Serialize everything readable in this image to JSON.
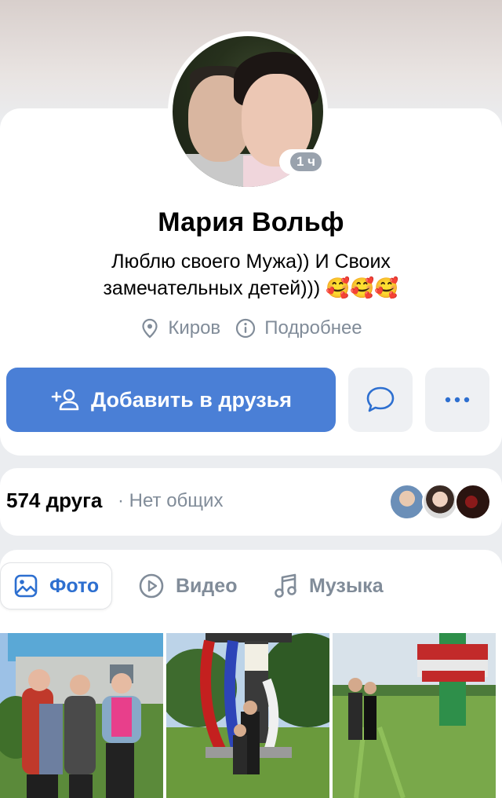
{
  "profile": {
    "name": "Мария Вольф",
    "status_line1": "Люблю своего Мужа)) И Своих",
    "status_line2": "замечательных детей))) 🥰🥰🥰",
    "online_badge": "1 ч",
    "city": "Киров",
    "details_label": "Подробнее"
  },
  "actions": {
    "add_friend_label": "Добавить в друзья",
    "message_icon": "chat-bubble-icon",
    "more_icon": "more-horizontal-icon"
  },
  "friends": {
    "count_label": "574 друга",
    "common_label": "· Нет общих"
  },
  "media_tabs": [
    {
      "label": "Фото",
      "icon": "photo-icon",
      "active": true
    },
    {
      "label": "Видео",
      "icon": "video-icon",
      "active": false
    },
    {
      "label": "Музыка",
      "icon": "music-icon",
      "active": false
    }
  ],
  "colors": {
    "primary": "#4a7fd6",
    "secondary_text": "#818c99",
    "active_tab": "#2d6fd0"
  }
}
